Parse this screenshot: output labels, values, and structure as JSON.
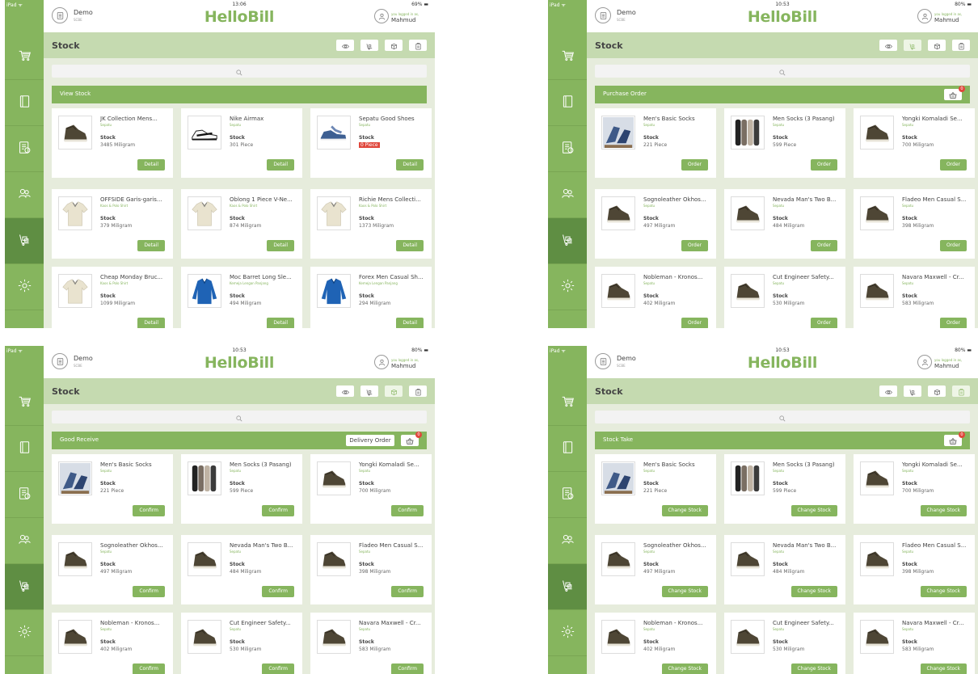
{
  "status": {
    "device": "iPad ᯤ"
  },
  "common": {
    "app_title": "HelloBill",
    "store_name": "Demo",
    "store_sub": "SCBE",
    "user_pre": "you logged in as,",
    "user_name": "Mahmud",
    "page_title": "Stock",
    "stock_label": "Stock"
  },
  "icons": {
    "sidebar": [
      "cart-icon",
      "notebook-icon",
      "report-icon",
      "customers-icon",
      "stock-icon",
      "settings-icon"
    ],
    "modes": [
      "eye-icon",
      "stock-cart-icon",
      "receive-icon",
      "stocktake-icon"
    ],
    "search": "search-icon",
    "basket": "basket-icon"
  },
  "colors": {
    "accent": "#86b55e",
    "accent_dark": "#5f8e43",
    "light_bar": "#c5dab0",
    "bg": "#e6ecdc",
    "alert": "#e0473c"
  },
  "panels": [
    {
      "time": "13:06",
      "battery": "69% ▬",
      "section_title": "View Stock",
      "button_label": "Detail",
      "basket_count": "",
      "delivery_label": "",
      "products": [
        {
          "name": "JK Collection Mens...",
          "category": "Sepatu",
          "stock": "3485 Miligram",
          "img": "boot",
          "low": false
        },
        {
          "name": "Nike Airmax",
          "category": "Sepatu",
          "stock": "301 Piece",
          "img": "sneaker",
          "low": false
        },
        {
          "name": "Sepatu Good Shoes",
          "category": "Sepatu",
          "stock": "0 Piece",
          "img": "blue-shoe",
          "low": true
        },
        {
          "name": "OFFSIDE Garis-garis...",
          "category": "Kaos & Polo Shirt",
          "stock": "379 Miligram",
          "img": "polo",
          "low": false
        },
        {
          "name": "Oblong 1 Piece V-Ne...",
          "category": "Kaos & Polo Shirt",
          "stock": "874 Miligram",
          "img": "polo",
          "low": false
        },
        {
          "name": "Richie Mens Collecti...",
          "category": "Kaos & Polo Shirt",
          "stock": "1373 Miligram",
          "img": "polo",
          "low": false
        },
        {
          "name": "Cheap Monday Bruc...",
          "category": "Kaos & Polo Shirt",
          "stock": "1099 Miligram",
          "img": "polo",
          "low": false
        },
        {
          "name": "Moc Barret Long Sle...",
          "category": "Kemeja Lengan Panjang",
          "stock": "494 Miligram",
          "img": "shirt",
          "low": false
        },
        {
          "name": "Forex Men Casual Sh...",
          "category": "Kemeja Lengan Panjang",
          "stock": "294 Miligram",
          "img": "shirt",
          "low": false
        }
      ]
    },
    {
      "time": "10:53",
      "battery": "80% ▬",
      "section_title": "Purchase Order",
      "button_label": "Order",
      "basket_count": "0",
      "delivery_label": "",
      "products": [
        {
          "name": "Men's Basic Socks",
          "category": "Sepatu",
          "stock": "221 Piece",
          "img": "socks-photo",
          "low": false
        },
        {
          "name": "Men Socks (3 Pasang)",
          "category": "Sepatu",
          "stock": "599 Piece",
          "img": "socks",
          "low": false
        },
        {
          "name": "Yongki Komaladi Se...",
          "category": "Sepatu",
          "stock": "700 Miligram",
          "img": "boot",
          "low": false
        },
        {
          "name": "Sognoleather Okhos...",
          "category": "Sepatu",
          "stock": "497 Miligram",
          "img": "boot",
          "low": false
        },
        {
          "name": "Nevada Man's Two B...",
          "category": "Sepatu",
          "stock": "484 Miligram",
          "img": "boot",
          "low": false
        },
        {
          "name": "Fladeo Men Casual S...",
          "category": "Sepatu",
          "stock": "398 Miligram",
          "img": "boot",
          "low": false
        },
        {
          "name": "Nobleman - Kronos...",
          "category": "Sepatu",
          "stock": "402 Miligram",
          "img": "boot",
          "low": false
        },
        {
          "name": "Cut Engineer Safety...",
          "category": "Sepatu",
          "stock": "530 Miligram",
          "img": "boot",
          "low": false
        },
        {
          "name": "Navara Maxwell - Cr...",
          "category": "Sepatu",
          "stock": "583 Miligram",
          "img": "boot",
          "low": false
        }
      ]
    },
    {
      "time": "10:53",
      "battery": "80% ▬",
      "section_title": "Good Receive",
      "button_label": "Confirm",
      "basket_count": "0",
      "delivery_label": "Delivery Order",
      "products": [
        {
          "name": "Men's Basic Socks",
          "category": "Sepatu",
          "stock": "221 Piece",
          "img": "socks-photo",
          "low": false
        },
        {
          "name": "Men Socks (3 Pasang)",
          "category": "Sepatu",
          "stock": "599 Piece",
          "img": "socks",
          "low": false
        },
        {
          "name": "Yongki Komaladi Se...",
          "category": "Sepatu",
          "stock": "700 Miligram",
          "img": "boot",
          "low": false
        },
        {
          "name": "Sognoleather Okhos...",
          "category": "Sepatu",
          "stock": "497 Miligram",
          "img": "boot",
          "low": false
        },
        {
          "name": "Nevada Man's Two B...",
          "category": "Sepatu",
          "stock": "484 Miligram",
          "img": "boot",
          "low": false
        },
        {
          "name": "Fladeo Men Casual S...",
          "category": "Sepatu",
          "stock": "398 Miligram",
          "img": "boot",
          "low": false
        },
        {
          "name": "Nobleman - Kronos...",
          "category": "Sepatu",
          "stock": "402 Miligram",
          "img": "boot",
          "low": false
        },
        {
          "name": "Cut Engineer Safety...",
          "category": "Sepatu",
          "stock": "530 Miligram",
          "img": "boot",
          "low": false
        },
        {
          "name": "Navara Maxwell - Cr...",
          "category": "Sepatu",
          "stock": "583 Miligram",
          "img": "boot",
          "low": false
        }
      ]
    },
    {
      "time": "10:53",
      "battery": "80% ▬",
      "section_title": "Stock Take",
      "button_label": "Change Stock",
      "basket_count": "0",
      "delivery_label": "",
      "products": [
        {
          "name": "Men's Basic Socks",
          "category": "Sepatu",
          "stock": "221 Piece",
          "img": "socks-photo",
          "low": false
        },
        {
          "name": "Men Socks (3 Pasang)",
          "category": "Sepatu",
          "stock": "599 Piece",
          "img": "socks",
          "low": false
        },
        {
          "name": "Yongki Komaladi Se...",
          "category": "Sepatu",
          "stock": "700 Miligram",
          "img": "boot",
          "low": false
        },
        {
          "name": "Sognoleather Okhos...",
          "category": "Sepatu",
          "stock": "497 Miligram",
          "img": "boot",
          "low": false
        },
        {
          "name": "Nevada Man's Two B...",
          "category": "Sepatu",
          "stock": "484 Miligram",
          "img": "boot",
          "low": false
        },
        {
          "name": "Fladeo Men Casual S...",
          "category": "Sepatu",
          "stock": "398 Miligram",
          "img": "boot",
          "low": false
        },
        {
          "name": "Nobleman - Kronos...",
          "category": "Sepatu",
          "stock": "402 Miligram",
          "img": "boot",
          "low": false
        },
        {
          "name": "Cut Engineer Safety...",
          "category": "Sepatu",
          "stock": "530 Miligram",
          "img": "boot",
          "low": false
        },
        {
          "name": "Navara Maxwell - Cr...",
          "category": "Sepatu",
          "stock": "583 Miligram",
          "img": "boot",
          "low": false
        }
      ]
    }
  ]
}
